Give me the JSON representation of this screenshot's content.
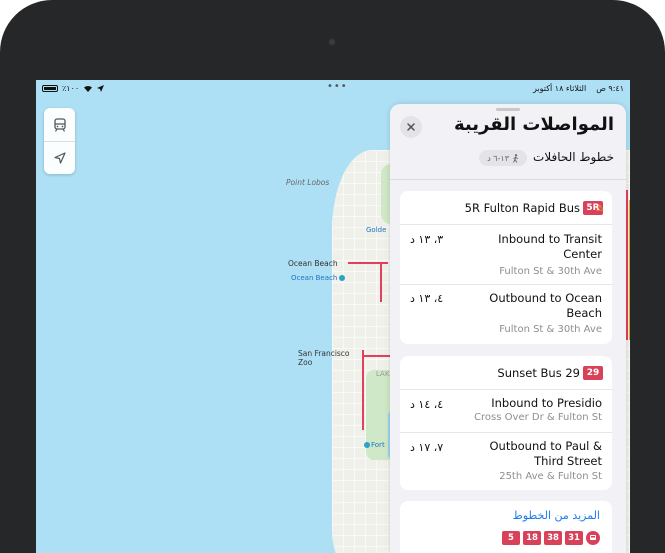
{
  "status_bar": {
    "time": "٩:٤١ ص",
    "date": "الثلاثاء ١٨ أكتوبر",
    "battery_pct": "٪١٠٠"
  },
  "map": {
    "labels": {
      "point_lobos": "Point Lobos",
      "ocean_beach": "Ocean Beach",
      "ocean_beach_poi": "Ocean Beach",
      "golden_gate": "Golde",
      "sf_zoo": "San Francisco Zoo",
      "fort": "Fort",
      "lake": "LAK"
    }
  },
  "panel": {
    "title": "المواصلات القريبة",
    "subtitle": "خطوط الحافلات",
    "walk_time": "١٣-٦ د",
    "groups": [
      {
        "name": "5R Fulton Rapid Bus",
        "badge": "5R",
        "warning": true,
        "rows": [
          {
            "destination": "Inbound to Transit Center",
            "stop": "Fulton St & 30th Ave",
            "time": "٣، ١٣ د"
          },
          {
            "destination": "Outbound to Ocean Beach",
            "stop": "Fulton St & 30th Ave",
            "time": "٤، ١٣ د"
          }
        ]
      },
      {
        "name": "Sunset Bus 29",
        "badge": "29",
        "warning": false,
        "rows": [
          {
            "destination": "Inbound to Presidio",
            "stop": "Cross Over Dr & Fulton St",
            "time": "٤، ١٤ د"
          },
          {
            "destination": "Outbound to Paul & Third Street",
            "stop": "25th Ave & Fulton St",
            "time": "٧، ١٧ د"
          }
        ]
      }
    ],
    "more_lines": "المزيد من الخطوط",
    "more_routes": [
      "5",
      "18",
      "38",
      "31"
    ]
  },
  "colors": {
    "route_red": "#d8415a",
    "link_blue": "#1a7cf0",
    "water": "#aee0f5"
  }
}
